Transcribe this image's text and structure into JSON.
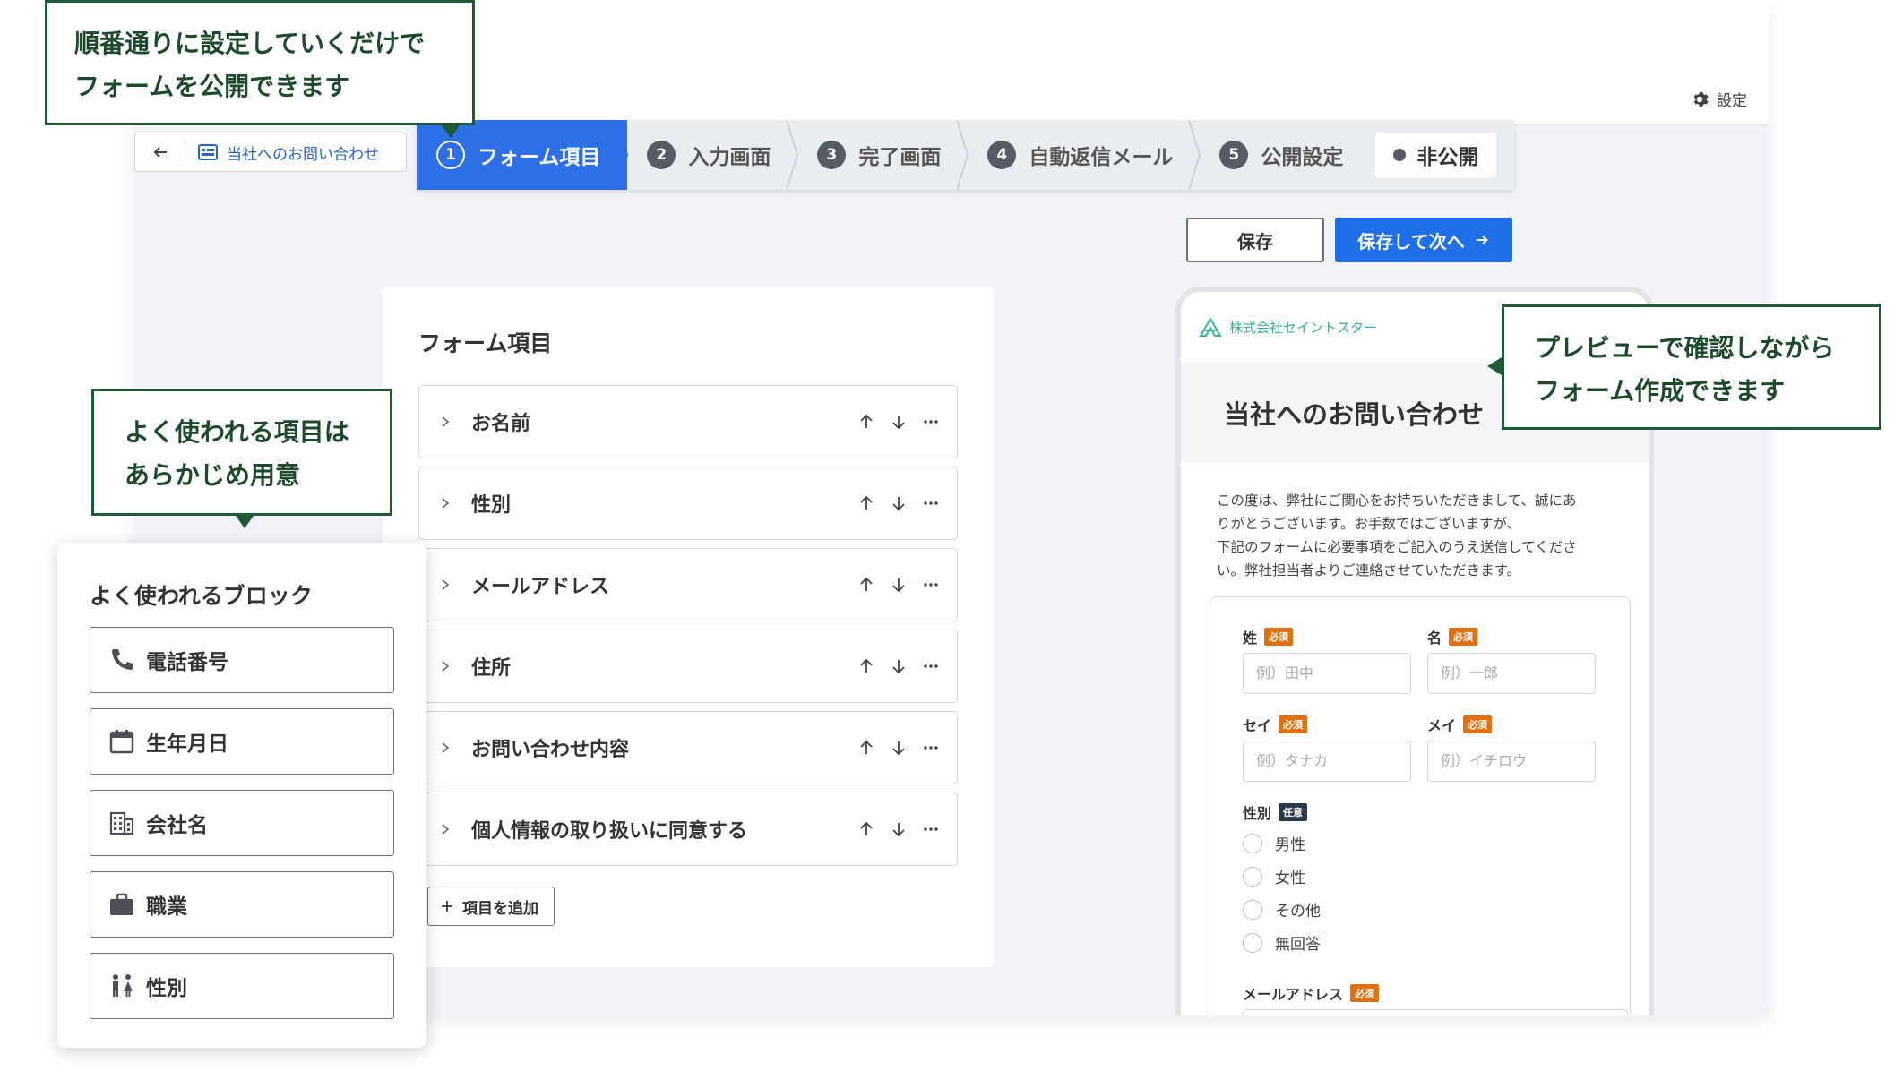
{
  "header": {
    "settings_label": "設定",
    "form_name": "当社へのお問い合わせ"
  },
  "steps": [
    {
      "num": "1",
      "label": "フォーム項目",
      "active": true
    },
    {
      "num": "2",
      "label": "入力画面"
    },
    {
      "num": "3",
      "label": "完了画面"
    },
    {
      "num": "4",
      "label": "自動返信メール"
    },
    {
      "num": "5",
      "label": "公開設定"
    }
  ],
  "status": {
    "label": "非公開"
  },
  "actions": {
    "save": "保存",
    "save_next": "保存して次へ"
  },
  "items_panel": {
    "title": "フォーム項目",
    "items": [
      "お名前",
      "性別",
      "メールアドレス",
      "住所",
      "お問い合わせ内容",
      "個人情報の取り扱いに同意する"
    ],
    "add_label": "項目を追加"
  },
  "blocks_panel": {
    "title": "よく使われるブロック",
    "items": [
      {
        "label": "電話番号",
        "icon": "phone-icon"
      },
      {
        "label": "生年月日",
        "icon": "calendar-icon"
      },
      {
        "label": "会社名",
        "icon": "building-icon"
      },
      {
        "label": "職業",
        "icon": "briefcase-icon"
      },
      {
        "label": "性別",
        "icon": "gender-icon"
      }
    ]
  },
  "preview": {
    "company": "株式会社セイントスター",
    "title": "当社へのお問い合わせ",
    "intro_lines": [
      "この度は、弊社にご関心をお持ちいただきまして、誠にあ",
      "りがとうございます。お手数ではございますが、",
      "下記のフォームに必要事項をご記入のうえ送信してくださ",
      "い。弊社担当者よりご連絡させていただきます。"
    ],
    "required_badge": "必須",
    "optional_badge": "任意",
    "fields": {
      "sei": {
        "label": "姓",
        "placeholder": "例）田中"
      },
      "mei": {
        "label": "名",
        "placeholder": "例）一郎"
      },
      "sei_kana": {
        "label": "セイ",
        "placeholder": "例）タナカ"
      },
      "mei_kana": {
        "label": "メイ",
        "placeholder": "例）イチロウ"
      },
      "gender": {
        "label": "性別",
        "options": [
          "男性",
          "女性",
          "その他",
          "無回答"
        ]
      },
      "email": {
        "label": "メールアドレス"
      }
    }
  },
  "callouts": {
    "steps": [
      "順番通りに設定していくだけで",
      "フォームを公開できます"
    ],
    "blocks": [
      "よく使われる項目は",
      "あらかじめ用意"
    ],
    "preview": [
      "プレビューで確認しながら",
      "フォーム作成できます"
    ]
  },
  "colors": {
    "primary": "#1f6fe8",
    "callout_border": "#1e5b34",
    "required": "#e2700e",
    "brand_green": "#3ab39a"
  }
}
